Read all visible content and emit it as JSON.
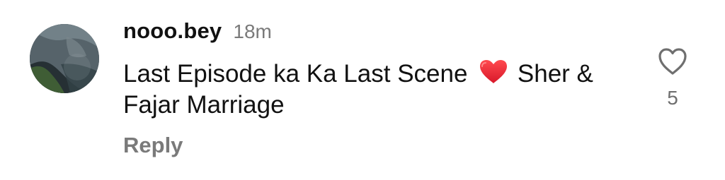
{
  "comment": {
    "username": "nooo.bey",
    "time": "18m",
    "text_before_emoji": "Last Episode ka Ka Last Scene",
    "emoji_name": "red-heart-emoji",
    "text_after_emoji": "Sher & Fajar Marriage",
    "reply_label": "Reply",
    "like_icon": "heart-outline-icon",
    "like_count": "5"
  },
  "colors": {
    "text_primary": "#111111",
    "text_secondary": "#7a7a7a",
    "heart_red": "#e0202d"
  }
}
